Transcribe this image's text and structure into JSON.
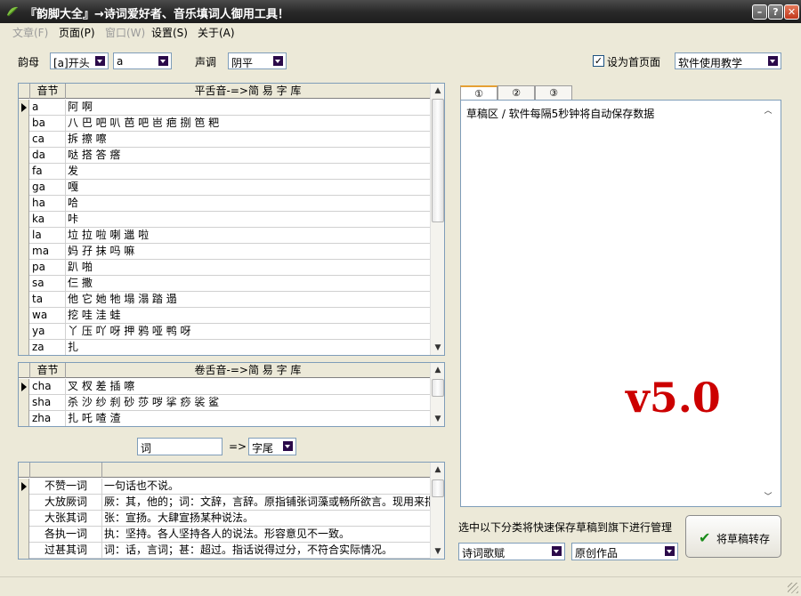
{
  "window": {
    "title": "『韵脚大全』→诗词爱好者、音乐填词人御用工具！"
  },
  "menu": [
    {
      "label": "文章(F)",
      "disabled": true
    },
    {
      "label": "页面(P)",
      "disabled": false
    },
    {
      "label": "窗口(W)",
      "disabled": true
    },
    {
      "label": "设置(S)",
      "disabled": false
    },
    {
      "label": "关于(A)",
      "disabled": false
    }
  ],
  "toolbar": {
    "rhyme_label": "韵母",
    "rhyme_mode": "[a]开头",
    "rhyme_value": "a",
    "tone_label": "声调",
    "tone_value": "阴平",
    "homepage_checkbox_label": "设为首页面",
    "homepage_checked": true,
    "tutorial_select": "软件使用教学"
  },
  "flat_table": {
    "headers": [
      "音节",
      "平舌音-=>简 易 字 库"
    ],
    "rows": [
      [
        "a",
        "阿 啊"
      ],
      [
        "ba",
        "八 巴 吧 叭 芭 吧 岜 疤 捌 笆 粑"
      ],
      [
        "ca",
        "拆 擦 嚓"
      ],
      [
        "da",
        "哒 搭 答 瘩"
      ],
      [
        "fa",
        "发"
      ],
      [
        "ga",
        "嘎"
      ],
      [
        "ha",
        "哈"
      ],
      [
        "ka",
        "咔"
      ],
      [
        "la",
        "垃 拉 啦 喇 邋 啦"
      ],
      [
        "ma",
        "妈 孖 抹 吗 嘛"
      ],
      [
        "pa",
        "趴 啪"
      ],
      [
        "sa",
        "仨 撒"
      ],
      [
        "ta",
        "他 它 她 牠 塌 溻 踏 遢"
      ],
      [
        "wa",
        "挖 哇 洼 蛙"
      ],
      [
        "ya",
        "丫 压 吖 呀 押 鸦 哑 鸭 呀"
      ],
      [
        "za",
        "扎"
      ]
    ]
  },
  "retroflex_table": {
    "headers": [
      "音节",
      "卷舌音-=>简 易 字 库"
    ],
    "rows": [
      [
        "cha",
        "叉 杈 差 插 嚓"
      ],
      [
        "sha",
        "杀 沙 纱 刹 砂 莎 哕 挲 痧 裟 鲨"
      ],
      [
        "zha",
        "扎 吒 喳 渣"
      ]
    ]
  },
  "search": {
    "term": "词",
    "arrow": "=>",
    "mode": "字尾"
  },
  "idiom_table": {
    "rows": [
      [
        "不赞一词",
        "一句话也不说。"
      ],
      [
        "大放厥词",
        "厥：其，他的；词：文辞，言辞。原指铺张词藻或畅所欲言。现用来指"
      ],
      [
        "大张其词",
        "张：宣扬。大肆宣扬某种说法。"
      ],
      [
        "各执一词",
        "执：坚持。各人坚持各人的说法。形容意见不一致。"
      ],
      [
        "过甚其词",
        "词：话，言词；甚：超过。指话说得过分，不符合实际情况。"
      ]
    ]
  },
  "tabs": [
    "①",
    "②",
    "③"
  ],
  "draft": {
    "text": "草稿区 / 软件每隔5秒钟将自动保存数据"
  },
  "version": "v5.0",
  "save_area": {
    "hint": "选中以下分类将快速保存草稿到旗下进行管理",
    "category": "诗词歌赋",
    "type": "原创作品",
    "button_label": "将草稿转存"
  }
}
